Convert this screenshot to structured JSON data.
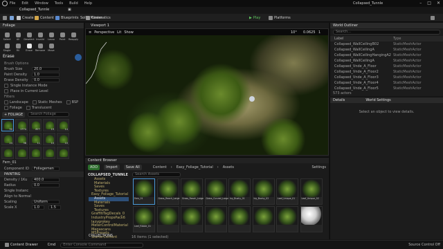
{
  "window": {
    "project_title": "Collapsed_Tunnle",
    "map_tab": "Collapsed_Tunnle"
  },
  "menu": [
    "File",
    "Edit",
    "Window",
    "Tools",
    "Build",
    "Help"
  ],
  "toolbar": {
    "create": "Create",
    "content": "Content",
    "blueprints": "Blueprints",
    "cinematics": "Cinematics",
    "play": "Play",
    "platforms": "Platforms",
    "solid_master": "Solid_Master"
  },
  "foliage": {
    "title": "Foliage",
    "modes": [
      "Select",
      "All",
      "Deselect",
      "Invalid",
      "Lasso",
      "Paint",
      "Reapply",
      "Single",
      "Fill",
      "Erase",
      "Remove",
      "Move"
    ],
    "active_mode": "Erase",
    "mode_title": "Erase",
    "brush_section": "Brush Options",
    "brush_size_label": "Brush Size",
    "brush_size": "20.0",
    "paint_density_label": "Paint Density",
    "paint_density": "1.0",
    "erase_density_label": "Erase Density",
    "erase_density": "0.0",
    "single_instance_label": "Single Instance Mode",
    "place_label": "Place in Current Level",
    "filters_label": "Filters",
    "landscape": "Landscape",
    "static_meshes": "Static Meshes",
    "bsp": "BSP",
    "foliage_filter": "Foliage",
    "translucent": "Translucent",
    "list_header": "+ FOLIAGE",
    "search_placeholder": "Search Foliage",
    "thumb_counts": [
      "90",
      "1774",
      "877",
      "19",
      "14",
      "24",
      "38",
      "11",
      "10",
      "10",
      "",
      "",
      "",
      "",
      ""
    ],
    "selected_name": "Fern_01",
    "component_label": "Component ID",
    "component_value": "Foliagemen",
    "painting_header": "PAINTING",
    "density_label": "Density / 1Ku",
    "density": "400.0",
    "radius_label": "Radius",
    "radius": "0.0",
    "single_instance_prop": "Single Instanc",
    "align_label": "Align to Normal",
    "scaling_label": "Scaling",
    "scaling": "Uniform",
    "scale_x_label": "Scale X",
    "scale_min": "1.0",
    "scale_max": "1.5"
  },
  "viewport": {
    "tab": "Viewport 1",
    "perspective": "Perspective",
    "lit": "Lit",
    "show": "Show",
    "angle": "10°",
    "scale": "0.0625",
    "speed": "1"
  },
  "outliner": {
    "title": "World Outliner",
    "search_placeholder": "Search...",
    "col_label": "Label",
    "col_type": "Type",
    "rows": [
      {
        "label": "Collapsed_WallCeilingB02",
        "type": "StaticMeshActor"
      },
      {
        "label": "Collapsed_WallCeilingA",
        "type": "StaticMeshActor"
      },
      {
        "label": "Collapsed_WallCeilingHangingA2",
        "type": "StaticMeshActor"
      },
      {
        "label": "Collapsed_WallCeilingA",
        "type": "StaticMeshActor"
      },
      {
        "label": "Collapsed_Vnde_A_Floor",
        "type": "StaticMeshActor"
      },
      {
        "label": "Collapsed_Vnde_A_Floor2",
        "type": "StaticMeshActor"
      },
      {
        "label": "Collapsed_Vnde_A_Floor3",
        "type": "StaticMeshActor"
      },
      {
        "label": "Collapsed_Vnde_A_Floor4",
        "type": "StaticMeshActor"
      },
      {
        "label": "Collapsed_Vnde_A_Floor5",
        "type": "StaticMeshActor"
      }
    ],
    "count": "573 actors"
  },
  "details": {
    "title": "Details",
    "world_settings": "World Settings",
    "hint": "Select an object to view details."
  },
  "content_browser": {
    "title": "Content Browser",
    "add": "ADD",
    "import": "Import",
    "save_all": "Save All",
    "path": [
      "Content",
      "Easy_Foliage_Tutorial",
      "Assets"
    ],
    "settings": "Settings",
    "root": "COLLAPSED_TUNNLE",
    "tree": [
      "Assets",
      "Materials",
      "Saves",
      "Textures",
      "Easy_Foliage_Tutorial",
      "Assets",
      "Materials",
      "Saves",
      "Textures",
      "GraffitiTagDecals_0",
      "IndustryPropsPack6",
      "lazygrokey",
      "MeterControlMaterial",
      "Megascans",
      "MSPresets",
      "StarterContent"
    ],
    "tree_selected": 5,
    "collections": "COLLECTIONS",
    "search_placeholder": "Search Assets",
    "items_count": "16 items (1 selected)",
    "assets": [
      "Fern_01",
      "Grass_Reach_Large",
      "Grass_Reach_Large",
      "Grass_Curved_Large",
      "Ivy_Bushy_01",
      "Ivy_Bushy_02",
      "Leaf_Unique_01",
      "Leaf_Unique_02",
      "Leaf_Ribble_01",
      "",
      "",
      "",
      "",
      "",
      "",
      ""
    ]
  },
  "status": {
    "content_drawer": "Content Drawer",
    "cmd": "Cmd",
    "console_placeholder": "Enter Console Command",
    "source_control": "Source Control Off"
  }
}
